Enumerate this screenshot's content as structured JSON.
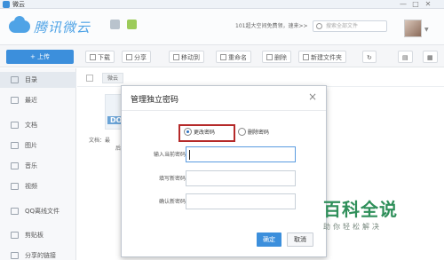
{
  "window": {
    "title": "微云"
  },
  "header": {
    "brand": "腾讯微云",
    "notice": "101超大空间免费领，速来>>",
    "search_placeholder": "搜索全部文件"
  },
  "toolbar": {
    "upload_label": "+ 上传",
    "download_label": "下载",
    "share_label": "分享",
    "move_label": "移动到",
    "rename_label": "重命名",
    "delete_label": "删除",
    "new_folder_label": "新建文件夹"
  },
  "sidebar": {
    "items": [
      {
        "label": "目录"
      },
      {
        "label": "最近"
      },
      {
        "label": "文档"
      },
      {
        "label": "图片"
      },
      {
        "label": "音乐"
      },
      {
        "label": "视频"
      },
      {
        "label": "QQ离线文件"
      },
      {
        "label": "剪贴板"
      },
      {
        "label": "分享的链接"
      }
    ]
  },
  "main": {
    "breadcrumb": "微云",
    "file_badge": "DO",
    "file_meta": "文档：最",
    "file_meta2": "后"
  },
  "dialog": {
    "title": "管理独立密码",
    "close": "×",
    "radio_change": "更改密码",
    "radio_delete": "删除密码",
    "label_current": "输入当前密码",
    "label_new": "填写新密码",
    "label_confirm": "确认新密码",
    "current_value": "",
    "new_value": "",
    "confirm_value": "",
    "ok_label": "确定",
    "cancel_label": "取消"
  },
  "watermark": {
    "main": "百科全说",
    "sub": "助你轻松解决"
  },
  "colors": {
    "accent": "#3c8fdc",
    "highlight": "#b52a2a",
    "watermark": "#2f8f5a"
  }
}
